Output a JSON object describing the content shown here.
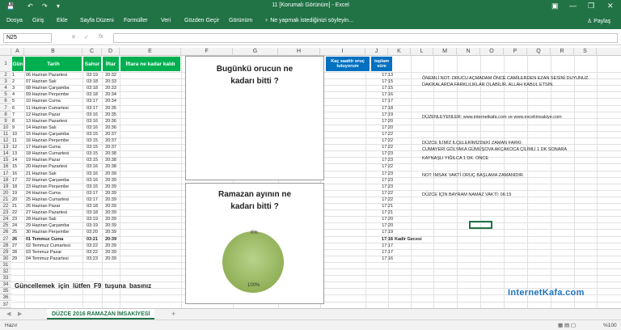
{
  "window": {
    "title": "11  [Korumalı Görünüm]  -  Excel",
    "minimize": "—",
    "restore": "❐",
    "close": "✕",
    "ribbon_options": "▣"
  },
  "quick_access": {
    "save": "💾",
    "undo": "↶",
    "redo": "↷",
    "customize": "▾"
  },
  "ribbon": {
    "tabs": [
      "Dosya",
      "Giriş",
      "Ekle",
      "Sayfa Düzeni",
      "Formüller",
      "Veri",
      "Gözden Geçir",
      "Görünüm"
    ],
    "tell_me": "Ne yapmak istediğinizi söyleyin...",
    "share": "Paylaş"
  },
  "formula_bar": {
    "name_box": "N25",
    "cancel": "✕",
    "enter": "✓",
    "fx": "fx",
    "value": ""
  },
  "columns": [
    "A",
    "B",
    "C",
    "D",
    "E",
    "F",
    "G",
    "H",
    "I",
    "J",
    "K",
    "L",
    "M",
    "N",
    "O",
    "P",
    "Q",
    "R",
    "S"
  ],
  "table": {
    "headers": {
      "gun": "Gün",
      "tarih": "Tarih",
      "sahur": "Sahur",
      "iftar": "İftar",
      "remaining": "İftara ne kadar kaldı",
      "hours": "Kaç saattir oruç tutuyorum",
      "total": "toplam süre"
    },
    "rows": [
      [
        "1",
        "06 Haziran Pazartesi",
        "03:19",
        "20:32",
        "17:13"
      ],
      [
        "2",
        "07 Haziran Salı",
        "03:18",
        "20:33",
        "17:15"
      ],
      [
        "3",
        "08 Haziran Çarşamba",
        "03:18",
        "20:33",
        "17:15"
      ],
      [
        "4",
        "09 Haziran Perşembe",
        "03:18",
        "20:34",
        "17:16"
      ],
      [
        "5",
        "10 Haziran Cuma",
        "03:17",
        "20:34",
        "17:17"
      ],
      [
        "6",
        "11 Haziran Cumartesi",
        "03:17",
        "20:35",
        "17:18"
      ],
      [
        "7",
        "12 Haziran Pazar",
        "03:16",
        "20:35",
        "17:19"
      ],
      [
        "8",
        "13 Haziran Pazartesi",
        "03:16",
        "20:36",
        "17:20"
      ],
      [
        "9",
        "14 Haziran Salı",
        "03:16",
        "20:36",
        "17:20"
      ],
      [
        "10",
        "15 Haziran Çarşamba",
        "03:15",
        "20:37",
        "17:22"
      ],
      [
        "11",
        "16 Haziran Perşembe",
        "03:15",
        "20:37",
        "17:22"
      ],
      [
        "12",
        "17 Haziran Cuma",
        "03:15",
        "20:37",
        "17:22"
      ],
      [
        "13",
        "18 Haziran Cumartesi",
        "03:15",
        "20:38",
        "17:23"
      ],
      [
        "14",
        "19 Haziran Pazar",
        "03:15",
        "20:38",
        "17:23"
      ],
      [
        "15",
        "20 Haziran Pazartesi",
        "03:16",
        "20:38",
        "17:22"
      ],
      [
        "16",
        "21 Haziran Salı",
        "03:16",
        "20:39",
        "17:23"
      ],
      [
        "17",
        "22 Haziran Çarşamba",
        "03:16",
        "20:39",
        "17:23"
      ],
      [
        "18",
        "23 Haziran Perşembe",
        "03:16",
        "20:39",
        "17:23"
      ],
      [
        "19",
        "24 Haziran Cuma",
        "03:17",
        "20:39",
        "17:22"
      ],
      [
        "20",
        "25 Haziran Cumartesi",
        "03:17",
        "20:39",
        "17:22"
      ],
      [
        "21",
        "26 Haziran Pazar",
        "03:18",
        "20:39",
        "17:21"
      ],
      [
        "22",
        "27 Haziran Pazartesi",
        "03:18",
        "20:39",
        "17:21"
      ],
      [
        "23",
        "28 Haziran Salı",
        "03:19",
        "20:39",
        "17:20"
      ],
      [
        "24",
        "29 Haziran Çarşamba",
        "03:19",
        "20:39",
        "17:20"
      ],
      [
        "25",
        "30 Haziran Perşembe",
        "03:20",
        "20:39",
        "17:19"
      ],
      [
        "26",
        "01 Temmuz Cuma",
        "03:21",
        "20:39",
        "17:18"
      ],
      [
        "27",
        "02 Temmuz Cumartesi",
        "03:22",
        "20:39",
        "17:17"
      ],
      [
        "28",
        "03 Temmuz Pazar",
        "03:22",
        "20:39",
        "17:17"
      ],
      [
        "29",
        "04 Temmuz Pazartesi",
        "03:23",
        "20:39",
        "17:16"
      ]
    ],
    "kadir_gecesi": "Kadir Gecesi"
  },
  "row_numbers": [
    "1",
    "2",
    "3",
    "4",
    "5",
    "6",
    "7",
    "8",
    "9",
    "10",
    "11",
    "12",
    "13",
    "14",
    "15",
    "16",
    "17",
    "18",
    "19",
    "20",
    "21",
    "22",
    "23",
    "24",
    "25",
    "26",
    "27",
    "28",
    "29",
    "30",
    "31",
    "32",
    "33",
    "34",
    "35",
    "36",
    "37"
  ],
  "box1": {
    "line1": "Bugünkü orucun ne",
    "line2": "kadarı bitti ?"
  },
  "box2": {
    "line1": "Ramazan ayının ne",
    "line2": "kadarı bitti ?",
    "pct_0": "0%",
    "pct_100": "100%"
  },
  "chart_data": {
    "type": "pie",
    "title": "Ramazan ayının ne kadarı bitti ?",
    "categories": [
      "0%",
      "100%"
    ],
    "values": [
      0,
      100
    ]
  },
  "notes": {
    "n1": "ÖNEMLİ NOT: ORUCU AÇMADAM ÖNCE CAMİLERDEN EZAN SESİNİ DUYUNUZ.",
    "n2": "DAKİKALARDA FARKLILIKLAR OLABİLİR.  ALLAH KABUL ETSİN.",
    "n3": "DÜZENLEYENLER: www.internetkafa.com ve www.excelimsakiye.com",
    "n4": "DÜZCE İLİMİZ İLÇELERİMİZDEKİ ZAMAN FARKI:",
    "n5": "CUMAYERİ GÖLYAKA GÜMÜŞOVA AKÇAKOCA ÇİLİMLİ 1 DK SONARA",
    "n6": "KAYNAŞLI YIĞILCA 1 DK. ONCE",
    "n7": "NOT: İMSAK VAKTİ ORUÇ BAŞLAMA ZAMANIDIR.",
    "n8": "DÜZCE İÇİN BAYRAM NAMAZ VAKTİ: 06:15"
  },
  "f9_text": "Güncellemek  için  lütfen F9  tuşuna  basınız",
  "logo": "InternetKafa.com",
  "sheet_tab": "DÜZCE 2016 RAMAZAN İMSAKİYESİ",
  "add_sheet": "+",
  "status": {
    "ready": "Hazır",
    "zoom": "%100"
  },
  "colors": {
    "excel_green": "#217346",
    "header_green": "#00b050",
    "header_blue": "#0070c0",
    "pie": "#9bbb59"
  }
}
